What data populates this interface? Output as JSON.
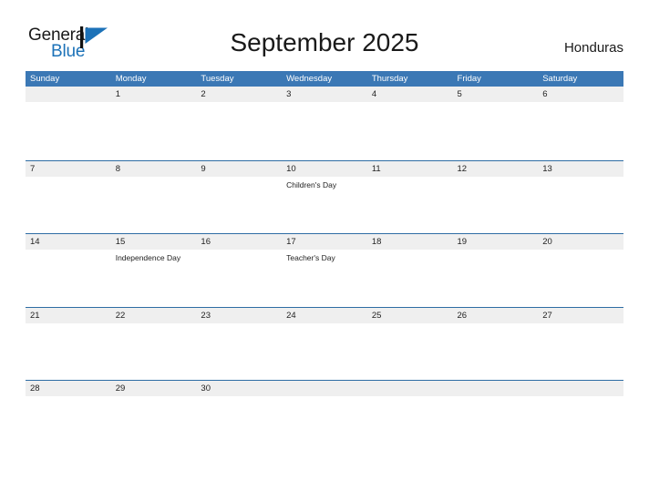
{
  "brand": {
    "name_part1": "General",
    "name_part2": "Blue",
    "logo_icon": "blue-triangle-flag-icon",
    "accent_color": "#1c72b8"
  },
  "header": {
    "title": "September 2025",
    "country": "Honduras"
  },
  "theme": {
    "header_blue": "#3b78b5",
    "rule_blue": "#2e6da4",
    "daynum_band": "#efefef",
    "text": "#222222"
  },
  "calendar": {
    "month": "September",
    "year": "2025",
    "weekdays": [
      "Sunday",
      "Monday",
      "Tuesday",
      "Wednesday",
      "Thursday",
      "Friday",
      "Saturday"
    ],
    "weeks": [
      [
        {
          "day": "",
          "event": ""
        },
        {
          "day": "1",
          "event": ""
        },
        {
          "day": "2",
          "event": ""
        },
        {
          "day": "3",
          "event": ""
        },
        {
          "day": "4",
          "event": ""
        },
        {
          "day": "5",
          "event": ""
        },
        {
          "day": "6",
          "event": ""
        }
      ],
      [
        {
          "day": "7",
          "event": ""
        },
        {
          "day": "8",
          "event": ""
        },
        {
          "day": "9",
          "event": ""
        },
        {
          "day": "10",
          "event": "Children's Day"
        },
        {
          "day": "11",
          "event": ""
        },
        {
          "day": "12",
          "event": ""
        },
        {
          "day": "13",
          "event": ""
        }
      ],
      [
        {
          "day": "14",
          "event": ""
        },
        {
          "day": "15",
          "event": "Independence Day"
        },
        {
          "day": "16",
          "event": ""
        },
        {
          "day": "17",
          "event": "Teacher's Day"
        },
        {
          "day": "18",
          "event": ""
        },
        {
          "day": "19",
          "event": ""
        },
        {
          "day": "20",
          "event": ""
        }
      ],
      [
        {
          "day": "21",
          "event": ""
        },
        {
          "day": "22",
          "event": ""
        },
        {
          "day": "23",
          "event": ""
        },
        {
          "day": "24",
          "event": ""
        },
        {
          "day": "25",
          "event": ""
        },
        {
          "day": "26",
          "event": ""
        },
        {
          "day": "27",
          "event": ""
        }
      ],
      [
        {
          "day": "28",
          "event": ""
        },
        {
          "day": "29",
          "event": ""
        },
        {
          "day": "30",
          "event": ""
        },
        {
          "day": "",
          "event": ""
        },
        {
          "day": "",
          "event": ""
        },
        {
          "day": "",
          "event": ""
        },
        {
          "day": "",
          "event": ""
        }
      ]
    ],
    "holidays": [
      {
        "date": "2025-09-10",
        "name": "Children's Day"
      },
      {
        "date": "2025-09-15",
        "name": "Independence Day"
      },
      {
        "date": "2025-09-17",
        "name": "Teacher's Day"
      }
    ]
  }
}
